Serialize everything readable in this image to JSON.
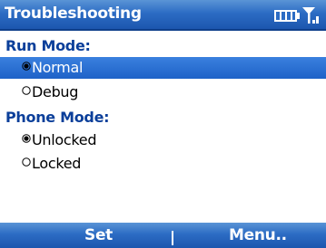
{
  "header": {
    "title": "Troubleshooting",
    "status_icons": [
      "battery-icon",
      "signal-icon"
    ]
  },
  "run_mode": {
    "label": "Run Mode:",
    "options": [
      {
        "label": "Normal",
        "checked": true,
        "highlighted": true
      },
      {
        "label": "Debug",
        "checked": false,
        "highlighted": false
      }
    ]
  },
  "phone_mode": {
    "label": "Phone Mode:",
    "options": [
      {
        "label": "Unlocked",
        "checked": true,
        "highlighted": false
      },
      {
        "label": "Locked",
        "checked": false,
        "highlighted": false
      }
    ]
  },
  "softkeys": {
    "left": "Set",
    "right": "Menu.."
  },
  "colors": {
    "title_bar": "#2c6cc4",
    "selection": "#2a70d4",
    "section_label": "#0b3f9a"
  }
}
